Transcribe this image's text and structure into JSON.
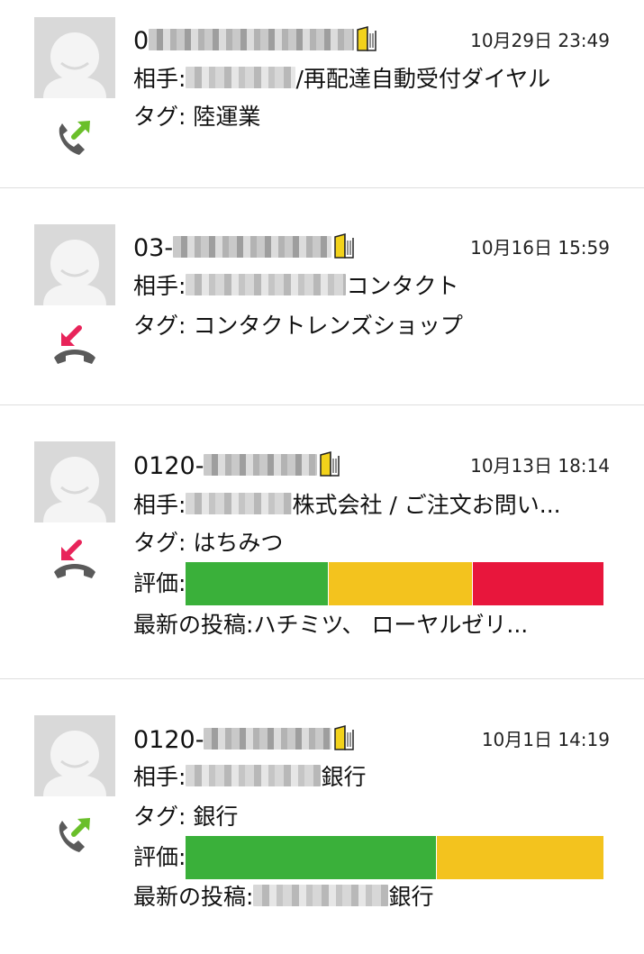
{
  "colors": {
    "green": "#3ab03a",
    "yellow": "#f3c31e",
    "red": "#e8163c",
    "outgoing_arrow": "#6abf2a",
    "incoming_arrow": "#e8245a",
    "handset": "#5a5a5a",
    "book": "#f2d21b"
  },
  "calls": [
    {
      "number_visible": "0",
      "date": "10月29日 23:49",
      "direction": "outgoing",
      "partner_label": "相手:",
      "partner_suffix": "/再配達自動受付ダイヤル",
      "tag_label": "タグ:",
      "tag": "陸運業"
    },
    {
      "number_visible": "03-",
      "date": "10月16日 15:59",
      "direction": "incoming",
      "partner_label": "相手:",
      "partner_suffix": "コンタクト",
      "tag_label": "タグ:",
      "tag": "コンタクトレンズショップ"
    },
    {
      "number_visible": "0120-",
      "date": "10月13日 18:14",
      "direction": "incoming",
      "partner_label": "相手:",
      "partner_suffix": "株式会社 / ご注文お問い...",
      "tag_label": "タグ:",
      "tag": "はちみつ",
      "rating_label": "評価:",
      "rating": [
        0.34,
        0.345,
        0.315
      ],
      "post_label": "最新の投稿:",
      "post": "ハチミツ、 ローヤルゼリ..."
    },
    {
      "number_visible": "0120-",
      "date": "10月1日 14:19",
      "direction": "outgoing",
      "partner_label": "相手:",
      "partner_suffix": "銀行",
      "tag_label": "タグ:",
      "tag": "銀行",
      "rating_label": "評価:",
      "rating": [
        0.6,
        0.4
      ],
      "post_label": "最新の投稿:",
      "post_suffix": "銀行"
    }
  ]
}
